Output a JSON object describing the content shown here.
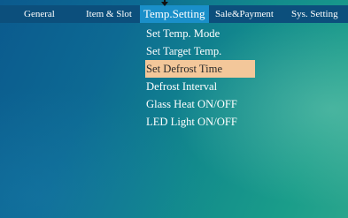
{
  "tabs": [
    {
      "label": "General"
    },
    {
      "label": "Item & Slot"
    },
    {
      "label": "Temp.Setting"
    },
    {
      "label": "Sale&Payment"
    },
    {
      "label": "Sys. Setting"
    }
  ],
  "active_tab": "Temp.Setting",
  "submenu": {
    "items": [
      {
        "label": "Set Temp. Mode"
      },
      {
        "label": "Set Target Temp."
      },
      {
        "label": "Set Defrost Time"
      },
      {
        "label": "Defrost Interval"
      },
      {
        "label": "Glass Heat ON/OFF"
      },
      {
        "label": "LED Light ON/OFF"
      }
    ],
    "selected": "Set Defrost Time"
  },
  "colors": {
    "menubar": "#0c4f7c",
    "active_tab": "#1a8fc9",
    "selected_item": "#f3c79a",
    "text": "#ffffff"
  },
  "icons": [
    "pointer-arrow-icon"
  ]
}
